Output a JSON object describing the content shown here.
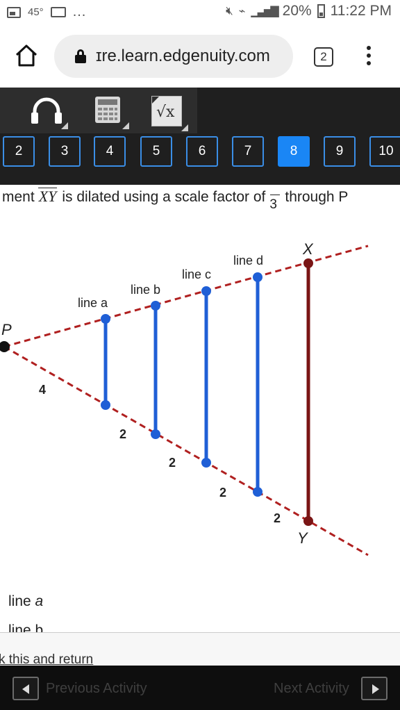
{
  "status_bar": {
    "temperature": "45°",
    "more": "...",
    "battery": "20%",
    "time": "11:22 PM"
  },
  "browser": {
    "url": "ɪre.learn.edgenuity.com",
    "tab_count": "2"
  },
  "toolbar": {
    "tools": [
      "headphones-icon",
      "calculator-icon",
      "square-root-icon"
    ],
    "sqrt_symbol": "√x"
  },
  "question_nav": {
    "items": [
      "2",
      "3",
      "4",
      "5",
      "6",
      "7",
      "8",
      "9",
      "10"
    ],
    "active": "8"
  },
  "question": {
    "prefix": "ment",
    "segment": "XY",
    "middle": "is dilated using a scale factor of",
    "denominator": "3",
    "suffix": "through P"
  },
  "diagram": {
    "point_p": "P",
    "point_x": "X",
    "point_y": "Y",
    "line_labels": [
      "line a",
      "line b",
      "line c",
      "line d"
    ],
    "lengths": [
      "4",
      "2",
      "2",
      "2",
      "2"
    ],
    "colors": {
      "blue": "#1f5fd6",
      "dark_red": "#7a1515",
      "dashed": "#b02020"
    }
  },
  "answers": {
    "option_a_prefix": "line ",
    "option_a_letter": "a",
    "option_b": "line b"
  },
  "mark_text": "k this and return",
  "footer": {
    "prev_label": "Previous Activity",
    "next_label": "Next Activity"
  }
}
